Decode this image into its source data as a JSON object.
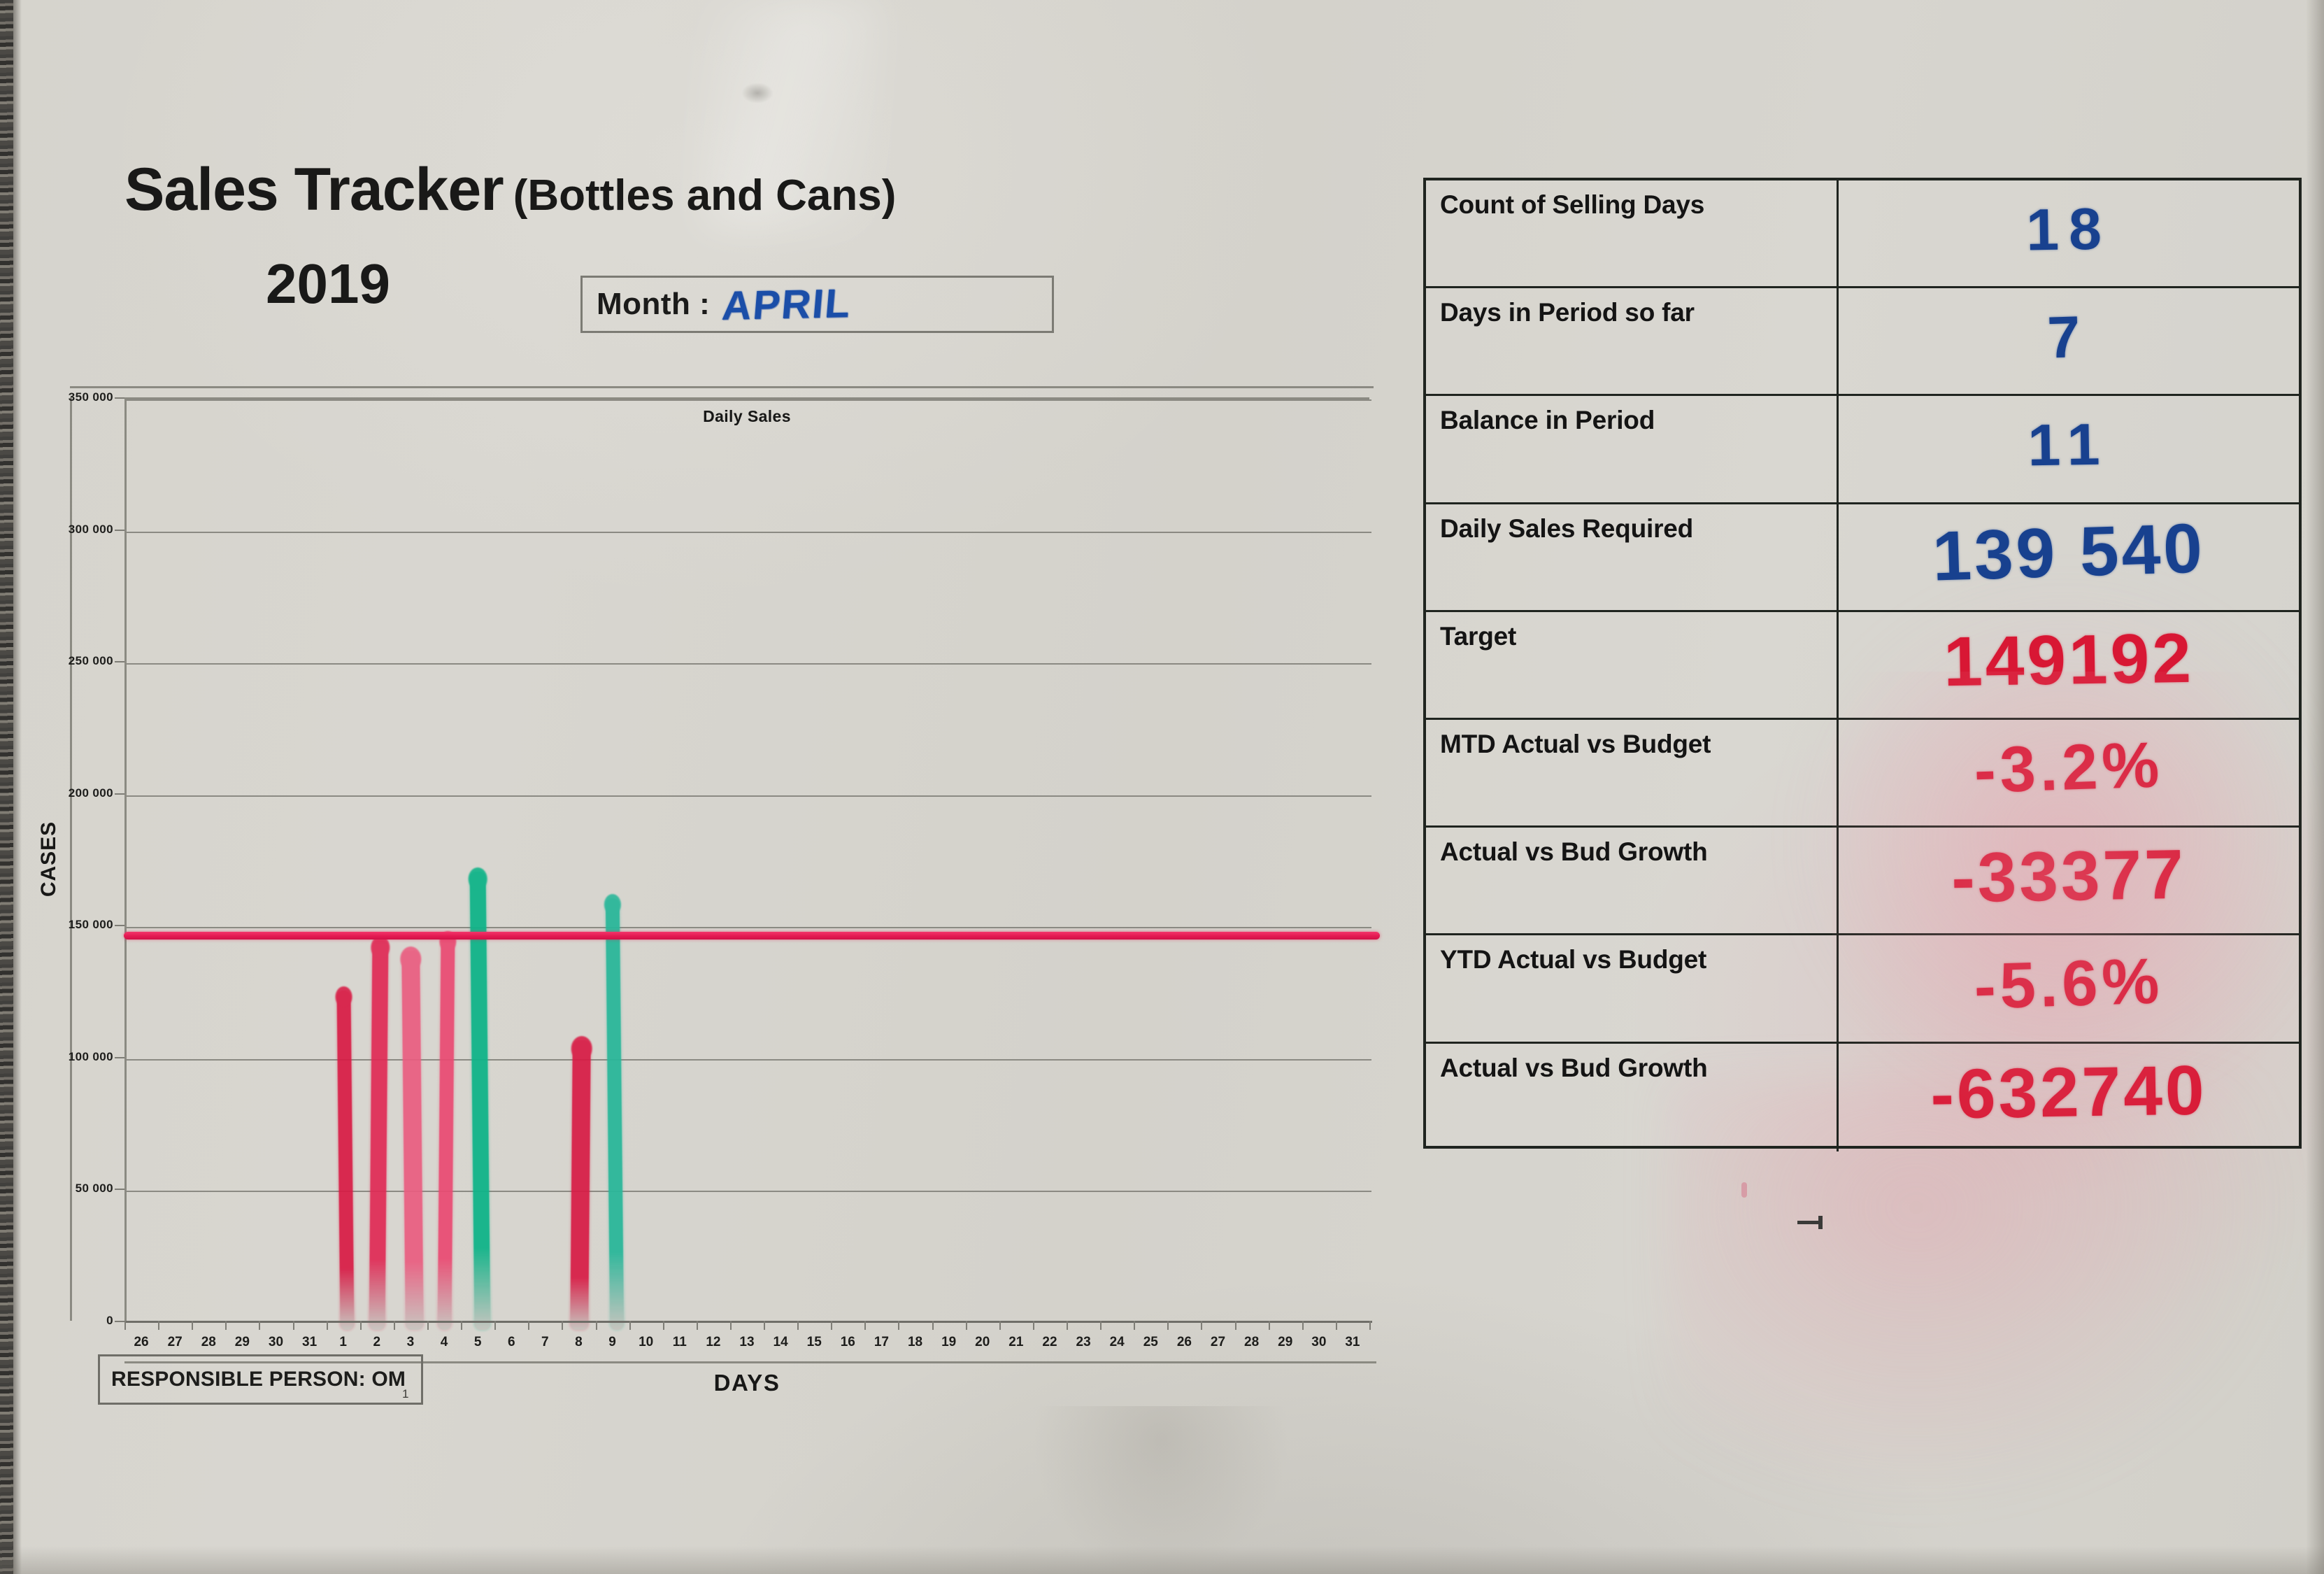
{
  "header": {
    "title_main": "Sales Tracker",
    "title_sub": "(Bottles and Cans)",
    "year": "2019",
    "month_label": "Month :",
    "month_value": "APRIL"
  },
  "chart_data": {
    "type": "bar",
    "title": "Daily Sales",
    "xlabel": "DAYS",
    "ylabel": "CASES",
    "ylim": [
      0,
      350000
    ],
    "ytick_labels": [
      "0",
      "50 000",
      "100 000",
      "150 000",
      "200 000",
      "250 000",
      "300 000",
      "350 000"
    ],
    "ytick_values": [
      0,
      50000,
      100000,
      150000,
      200000,
      250000,
      300000,
      350000
    ],
    "grid": true,
    "legend": "none",
    "categories": [
      "26",
      "27",
      "28",
      "29",
      "30",
      "31",
      "1",
      "2",
      "3",
      "4",
      "5",
      "6",
      "7",
      "8",
      "9",
      "10",
      "11",
      "12",
      "13",
      "14",
      "15",
      "16",
      "17",
      "18",
      "19",
      "20",
      "21",
      "22",
      "23",
      "24",
      "25",
      "26",
      "27",
      "28",
      "29",
      "30",
      "31"
    ],
    "target_line": {
      "label": "Target",
      "value": 147000,
      "color": "#e31a52"
    },
    "bars": [
      {
        "day": "1",
        "value": 126000,
        "color": "#d81b45",
        "kind": "below-target"
      },
      {
        "day": "2",
        "value": 145000,
        "color": "#e02a55",
        "kind": "below-target"
      },
      {
        "day": "3",
        "value": 141000,
        "color": "#ea5d80",
        "kind": "below-target"
      },
      {
        "day": "4",
        "value": 147000,
        "color": "#ea4a72",
        "kind": "below-target"
      },
      {
        "day": "5",
        "value": 171000,
        "color": "#10b489",
        "kind": "above-target"
      },
      {
        "day": "8",
        "value": 107000,
        "color": "#d81b45",
        "kind": "below-target"
      },
      {
        "day": "9",
        "value": 161000,
        "color": "#2bb79a",
        "kind": "above-target"
      }
    ]
  },
  "responsible": {
    "label": "RESPONSIBLE PERSON: OM",
    "mark": "1"
  },
  "stats_table": {
    "rows": [
      {
        "label": "Count of Selling Days",
        "value": "18",
        "ink": "blue",
        "size": "sm"
      },
      {
        "label": "Days in Period so far",
        "value": "7",
        "ink": "blue",
        "size": "sm"
      },
      {
        "label": "Balance in Period",
        "value": "11",
        "ink": "blue",
        "size": "sm"
      },
      {
        "label": "Daily Sales Required",
        "value": "139 540",
        "ink": "blue",
        "size": "lg"
      },
      {
        "label": "Target",
        "value": "149192",
        "ink": "red",
        "size": "lg"
      },
      {
        "label": "MTD Actual vs Budget",
        "value": "-3.2%",
        "ink": "red",
        "size": "md"
      },
      {
        "label": "Actual vs Bud Growth",
        "value": "-33377",
        "ink": "red",
        "size": "lg"
      },
      {
        "label": "YTD Actual vs Budget",
        "value": "-5.6%",
        "ink": "red",
        "size": "md"
      },
      {
        "label": "Actual vs Bud Growth",
        "value": "-632740",
        "ink": "red",
        "size": "lg"
      }
    ]
  },
  "colors": {
    "paper": "#d6d4cd",
    "ink_blue": "#18418f",
    "ink_red": "#d81734",
    "target_red": "#e31a52",
    "bar_green": "#10b489",
    "bar_pink": "#ea5d80",
    "rule": "#1f241f"
  }
}
